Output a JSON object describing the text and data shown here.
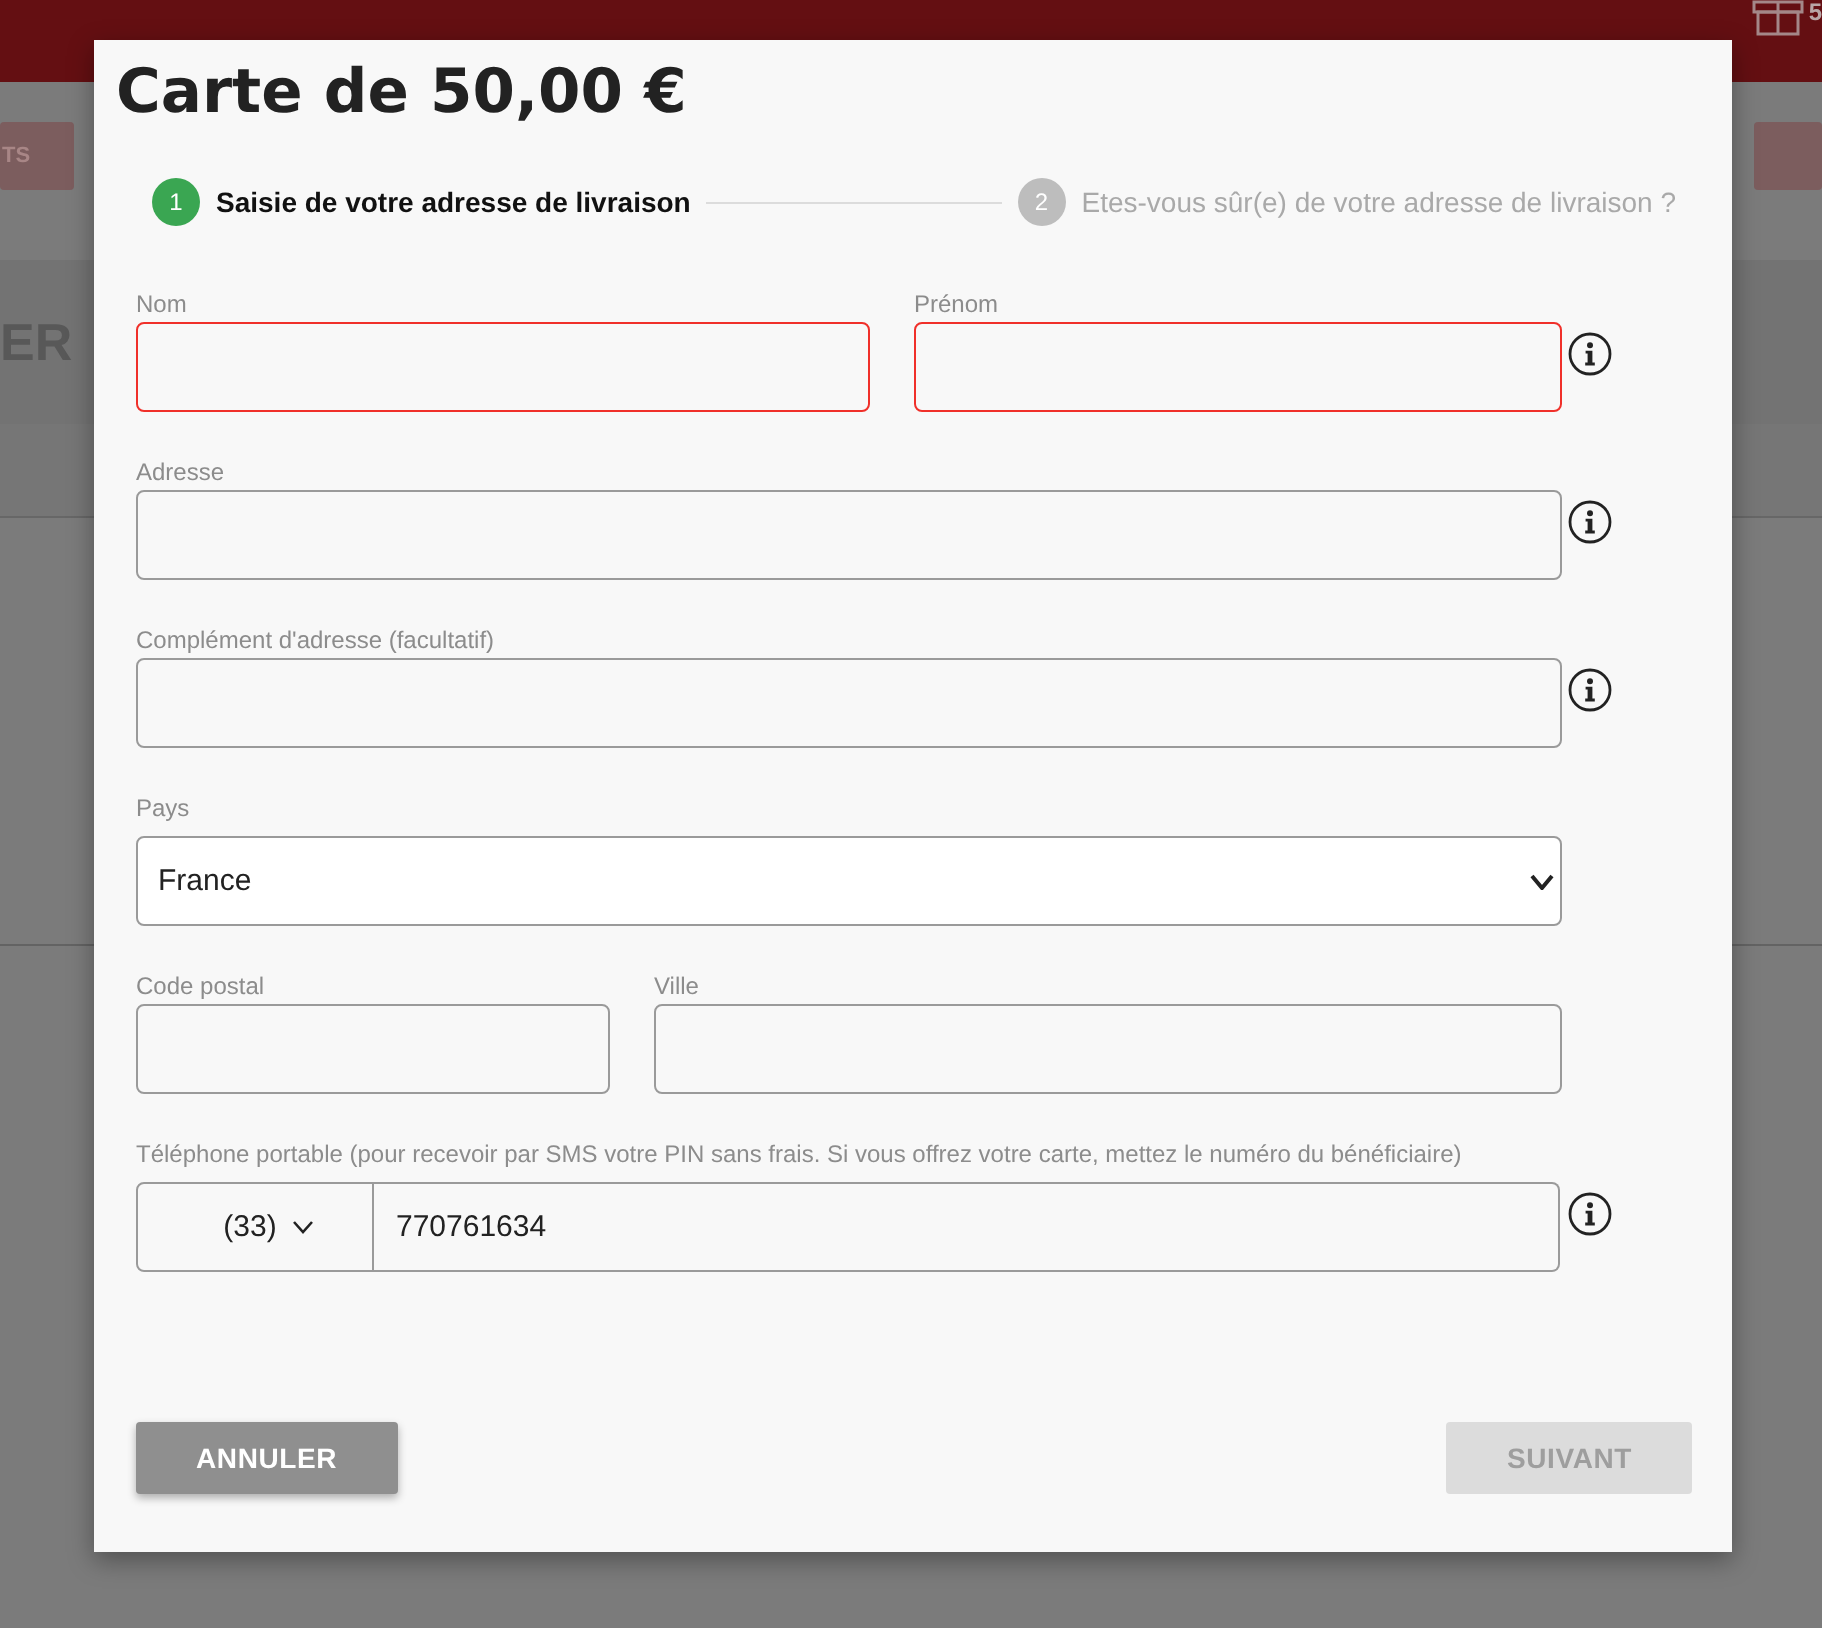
{
  "background": {
    "header": {
      "badge_count": "5"
    },
    "toolbar": {
      "left_button": "TS"
    },
    "heading": "ER"
  },
  "dialog": {
    "title": "Carte de 50,00 €",
    "steps": [
      {
        "number": "1",
        "label": "Saisie de votre adresse de livraison",
        "selected": true
      },
      {
        "number": "2",
        "label": "Etes-vous sûr(e) de votre adresse de livraison ?",
        "selected": false
      }
    ],
    "rows": [
      {
        "info": true,
        "fields": [
          {
            "kind": "text",
            "label": "Nom",
            "error": true
          },
          {
            "kind": "text",
            "label": "Prénom",
            "error": true
          }
        ]
      },
      {
        "info": true,
        "fields": [
          {
            "kind": "text",
            "label": "Adresse",
            "error": false
          }
        ]
      },
      {
        "info": true,
        "fields": [
          {
            "kind": "text",
            "label": "Complément d'adresse (facultatif)",
            "error": false
          }
        ]
      },
      {
        "info": false,
        "fields": [
          {
            "kind": "select",
            "label": "Pays",
            "value": "France",
            "error": false
          }
        ]
      },
      {
        "info": false,
        "fields": [
          {
            "kind": "text",
            "label": "Code postal",
            "error": false
          },
          {
            "kind": "text",
            "label": "Ville",
            "error": false
          }
        ]
      },
      {
        "info": true,
        "fields": [
          {
            "kind": "phone",
            "label": "Téléphone portable (pour recevoir par SMS votre PIN sans frais. Si vous offrez votre carte, mettez le numéro du bénéficiaire)",
            "country_code": "(33)",
            "value": "770761634",
            "error": false
          }
        ]
      }
    ],
    "buttons": [
      {
        "label": "ANNULER",
        "disabled": false
      },
      {
        "label": "SUIVANT",
        "disabled": true
      }
    ]
  }
}
